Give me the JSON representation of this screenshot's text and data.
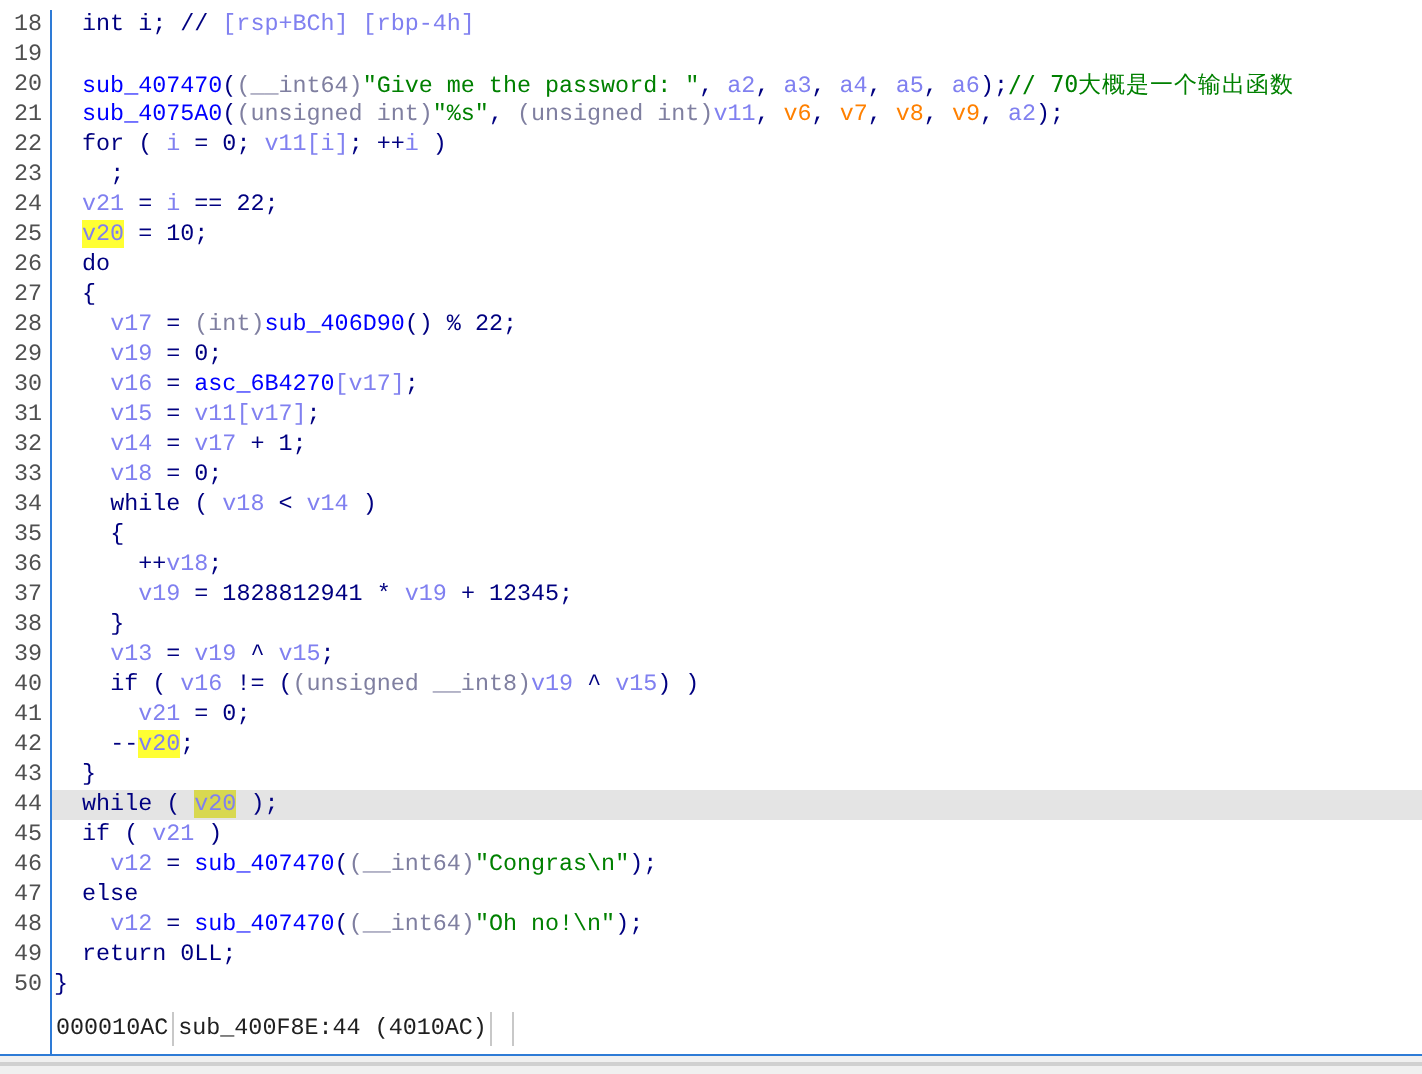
{
  "code": {
    "lines": [
      {
        "number": "18",
        "current": false,
        "tokens": [
          {
            "kind": "plain",
            "text": "  int i; // "
          },
          {
            "kind": "var",
            "text": "[rsp+BCh] [rbp-4h]"
          }
        ]
      },
      {
        "number": "19",
        "current": false
      },
      {
        "number": "20",
        "current": false,
        "tokens": [
          {
            "kind": "func",
            "text": "  sub_407470"
          },
          {
            "kind": "plain",
            "text": "("
          },
          {
            "kind": "cast",
            "text": "(__int64)"
          },
          {
            "kind": "string",
            "text": "\"Give me the password: \""
          },
          {
            "kind": "plain",
            "text": ", "
          },
          {
            "kind": "var",
            "text": "a2"
          },
          {
            "kind": "plain",
            "text": ", "
          },
          {
            "kind": "var",
            "text": "a3"
          },
          {
            "kind": "plain",
            "text": ", "
          },
          {
            "kind": "var",
            "text": "a4"
          },
          {
            "kind": "plain",
            "text": ", "
          },
          {
            "kind": "var",
            "text": "a5"
          },
          {
            "kind": "plain",
            "text": ", "
          },
          {
            "kind": "var",
            "text": "a6"
          },
          {
            "kind": "plain",
            "text": ");"
          },
          {
            "kind": "comment",
            "text": "// 70大概是一个输出函数"
          }
        ]
      },
      {
        "number": "21",
        "current": false,
        "tokens": [
          {
            "kind": "func",
            "text": "  sub_4075A0"
          },
          {
            "kind": "plain",
            "text": "("
          },
          {
            "kind": "cast",
            "text": "(unsigned int)"
          },
          {
            "kind": "string",
            "text": "\"%s\""
          },
          {
            "kind": "plain",
            "text": ", "
          },
          {
            "kind": "cast",
            "text": "(unsigned int)"
          },
          {
            "kind": "var",
            "text": "v11"
          },
          {
            "kind": "plain",
            "text": ", "
          },
          {
            "kind": "reg",
            "text": "v6"
          },
          {
            "kind": "plain",
            "text": ", "
          },
          {
            "kind": "reg",
            "text": "v7"
          },
          {
            "kind": "plain",
            "text": ", "
          },
          {
            "kind": "reg",
            "text": "v8"
          },
          {
            "kind": "plain",
            "text": ", "
          },
          {
            "kind": "reg",
            "text": "v9"
          },
          {
            "kind": "plain",
            "text": ", "
          },
          {
            "kind": "var",
            "text": "a2"
          },
          {
            "kind": "plain",
            "text": ");"
          }
        ]
      },
      {
        "number": "22",
        "current": false,
        "tokens": [
          {
            "kind": "plain",
            "text": "  for ( "
          },
          {
            "kind": "var",
            "text": "i"
          },
          {
            "kind": "plain",
            "text": " = 0; "
          },
          {
            "kind": "var",
            "text": "v11[i]"
          },
          {
            "kind": "plain",
            "text": "; ++"
          },
          {
            "kind": "var",
            "text": "i"
          },
          {
            "kind": "plain",
            "text": " )"
          }
        ]
      },
      {
        "number": "23",
        "current": false,
        "tokens": [
          {
            "kind": "plain",
            "text": "    ;"
          }
        ]
      },
      {
        "number": "24",
        "current": false,
        "tokens": [
          {
            "kind": "var",
            "text": "  v21"
          },
          {
            "kind": "plain",
            "text": " = "
          },
          {
            "kind": "var",
            "text": "i"
          },
          {
            "kind": "plain",
            "text": " == 22;"
          }
        ]
      },
      {
        "number": "25",
        "current": false,
        "tokens": [
          {
            "kind": "highlight",
            "text": "  v20"
          },
          {
            "kind": "plain",
            "text": " = 10;"
          }
        ]
      },
      {
        "number": "26",
        "current": false,
        "tokens": [
          {
            "kind": "plain",
            "text": "  do"
          }
        ]
      },
      {
        "number": "27",
        "current": false,
        "tokens": [
          {
            "kind": "plain",
            "text": "  {"
          }
        ]
      },
      {
        "number": "28",
        "current": false,
        "tokens": [
          {
            "kind": "var",
            "text": "    v17"
          },
          {
            "kind": "plain",
            "text": " = "
          },
          {
            "kind": "cast",
            "text": "(int)"
          },
          {
            "kind": "func",
            "text": "sub_406D90"
          },
          {
            "kind": "plain",
            "text": "() % 22;"
          }
        ]
      },
      {
        "number": "29",
        "current": false,
        "tokens": [
          {
            "kind": "var",
            "text": "    v19"
          },
          {
            "kind": "plain",
            "text": " = 0;"
          }
        ]
      },
      {
        "number": "30",
        "current": false,
        "tokens": [
          {
            "kind": "var",
            "text": "    v16"
          },
          {
            "kind": "plain",
            "text": " = "
          },
          {
            "kind": "func",
            "text": "asc_6B4270"
          },
          {
            "kind": "var",
            "text": "[v17]"
          },
          {
            "kind": "plain",
            "text": ";"
          }
        ]
      },
      {
        "number": "31",
        "current": false,
        "tokens": [
          {
            "kind": "var",
            "text": "    v15"
          },
          {
            "kind": "plain",
            "text": " = "
          },
          {
            "kind": "var",
            "text": "v11[v17]"
          },
          {
            "kind": "plain",
            "text": ";"
          }
        ]
      },
      {
        "number": "32",
        "current": false,
        "tokens": [
          {
            "kind": "var",
            "text": "    v14"
          },
          {
            "kind": "plain",
            "text": " = "
          },
          {
            "kind": "var",
            "text": "v17"
          },
          {
            "kind": "plain",
            "text": " + 1;"
          }
        ]
      },
      {
        "number": "33",
        "current": false,
        "tokens": [
          {
            "kind": "var",
            "text": "    v18"
          },
          {
            "kind": "plain",
            "text": " = 0;"
          }
        ]
      },
      {
        "number": "34",
        "current": false,
        "tokens": [
          {
            "kind": "plain",
            "text": "    while ( "
          },
          {
            "kind": "var",
            "text": "v18"
          },
          {
            "kind": "plain",
            "text": " < "
          },
          {
            "kind": "var",
            "text": "v14"
          },
          {
            "kind": "plain",
            "text": " )"
          }
        ]
      },
      {
        "number": "35",
        "current": false,
        "tokens": [
          {
            "kind": "plain",
            "text": "    {"
          }
        ]
      },
      {
        "number": "36",
        "current": false,
        "tokens": [
          {
            "kind": "plain",
            "text": "      ++"
          },
          {
            "kind": "var",
            "text": "v18"
          },
          {
            "kind": "plain",
            "text": ";"
          }
        ]
      },
      {
        "number": "37",
        "current": false,
        "tokens": [
          {
            "kind": "var",
            "text": "      v19"
          },
          {
            "kind": "plain",
            "text": " = 1828812941 * "
          },
          {
            "kind": "var",
            "text": "v19"
          },
          {
            "kind": "plain",
            "text": " + 12345;"
          }
        ]
      },
      {
        "number": "38",
        "current": false,
        "tokens": [
          {
            "kind": "plain",
            "text": "    }"
          }
        ]
      },
      {
        "number": "39",
        "current": false,
        "tokens": [
          {
            "kind": "var",
            "text": "    v13"
          },
          {
            "kind": "plain",
            "text": " = "
          },
          {
            "kind": "var",
            "text": "v19"
          },
          {
            "kind": "plain",
            "text": " ^ "
          },
          {
            "kind": "var",
            "text": "v15"
          },
          {
            "kind": "plain",
            "text": ";"
          }
        ]
      },
      {
        "number": "40",
        "current": false,
        "tokens": [
          {
            "kind": "plain",
            "text": "    if ( "
          },
          {
            "kind": "var",
            "text": "v16"
          },
          {
            "kind": "plain",
            "text": " != ("
          },
          {
            "kind": "cast",
            "text": "(unsigned __int8)"
          },
          {
            "kind": "var",
            "text": "v19"
          },
          {
            "kind": "plain",
            "text": " ^ "
          },
          {
            "kind": "var",
            "text": "v15"
          },
          {
            "kind": "plain",
            "text": ") )"
          }
        ]
      },
      {
        "number": "41",
        "current": false,
        "tokens": [
          {
            "kind": "var",
            "text": "      v21"
          },
          {
            "kind": "plain",
            "text": " = 0;"
          }
        ]
      },
      {
        "number": "42",
        "current": false,
        "tokens": [
          {
            "kind": "plain",
            "text": "    --"
          },
          {
            "kind": "highlight",
            "text": "v20"
          },
          {
            "kind": "plain",
            "text": ";"
          }
        ]
      },
      {
        "number": "43",
        "current": false,
        "tokens": [
          {
            "kind": "plain",
            "text": "  }"
          }
        ]
      },
      {
        "number": "44",
        "current": true,
        "tokens": [
          {
            "kind": "plain",
            "text": "  while ( "
          },
          {
            "kind": "highlight",
            "text": "v20"
          },
          {
            "kind": "plain",
            "text": " );"
          }
        ]
      },
      {
        "number": "45",
        "current": false,
        "tokens": [
          {
            "kind": "plain",
            "text": "  if ( "
          },
          {
            "kind": "var",
            "text": "v21"
          },
          {
            "kind": "plain",
            "text": " )"
          }
        ]
      },
      {
        "number": "46",
        "current": false,
        "tokens": [
          {
            "kind": "var",
            "text": "    v12"
          },
          {
            "kind": "plain",
            "text": " = "
          },
          {
            "kind": "func",
            "text": "sub_407470"
          },
          {
            "kind": "plain",
            "text": "("
          },
          {
            "kind": "cast",
            "text": "(__int64)"
          },
          {
            "kind": "string",
            "text": "\"Congras\\n\""
          },
          {
            "kind": "plain",
            "text": ");"
          }
        ]
      },
      {
        "number": "47",
        "current": false,
        "tokens": [
          {
            "kind": "plain",
            "text": "  else"
          }
        ]
      },
      {
        "number": "48",
        "current": false,
        "tokens": [
          {
            "kind": "var",
            "text": "    v12"
          },
          {
            "kind": "plain",
            "text": " = "
          },
          {
            "kind": "func",
            "text": "sub_407470"
          },
          {
            "kind": "plain",
            "text": "("
          },
          {
            "kind": "cast",
            "text": "(__int64)"
          },
          {
            "kind": "string",
            "text": "\"Oh no!\\n\""
          },
          {
            "kind": "plain",
            "text": ");"
          }
        ]
      },
      {
        "number": "49",
        "current": false,
        "tokens": [
          {
            "kind": "plain",
            "text": "  return 0LL;"
          }
        ]
      },
      {
        "number": "50",
        "current": false,
        "tokens": [
          {
            "kind": "plain",
            "text": "}"
          }
        ]
      }
    ]
  },
  "status_bar": {
    "cells": [
      "000010AC",
      "sub_400F8E:44 (4010AC)"
    ]
  }
}
